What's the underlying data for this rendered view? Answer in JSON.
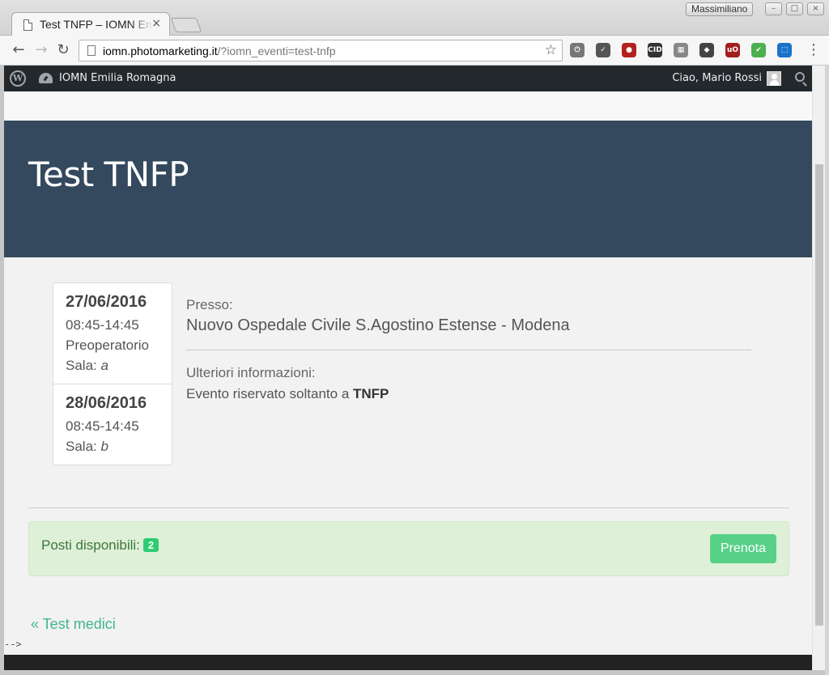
{
  "browser": {
    "tab_title": "Test TNFP – IOMN Emilia Romagna",
    "tab_close": "×",
    "profile_name": "Massimiliano",
    "window_buttons": [
      "–",
      "□",
      "×"
    ],
    "url_host": "iomn.photomarketing.it",
    "url_path": "/?iomn_eventi=test-tnfp",
    "back": "←",
    "forward": "→",
    "reload": "↻",
    "star": "☆",
    "menu": "⋮",
    "extensions": [
      {
        "name": "power-extension-icon",
        "label": "⏻",
        "color": "#777777"
      },
      {
        "name": "pocket-extension-icon",
        "label": "✓",
        "color": "#555555"
      },
      {
        "name": "map-pin-extension-icon",
        "label": "●",
        "color": "#b52020"
      },
      {
        "name": "cid-extension-icon",
        "label": "CID",
        "color": "#333333"
      },
      {
        "name": "bank-extension-icon",
        "label": "▦",
        "color": "#888888"
      },
      {
        "name": "bulb-extension-icon",
        "label": "◆",
        "color": "#444444"
      },
      {
        "name": "ublock-extension-icon",
        "label": "uO",
        "color": "#a31d1d"
      },
      {
        "name": "checkmark-extension-icon",
        "label": "✔",
        "color": "#4caf50"
      },
      {
        "name": "screenshot-extension-icon",
        "label": "⬚",
        "color": "#1a73c8"
      }
    ]
  },
  "adminbar": {
    "logo": "W",
    "site_name": "IOMN Emilia Romagna",
    "greeting": "Ciao, Mario Rossi"
  },
  "hero": {
    "title": "Test TNFP"
  },
  "dates": [
    {
      "date": "27/06/2016",
      "time": "08:45-14:45",
      "type": "Preoperatorio",
      "sala_label": "Sala:",
      "sala": "a"
    },
    {
      "date": "28/06/2016",
      "time": "08:45-14:45",
      "sala_label": "Sala:",
      "sala": "b"
    }
  ],
  "info": {
    "presso_label": "Presso:",
    "venue": "Nuovo Ospedale Civile S.Agostino Estense - Modena",
    "more_label": "Ulteriori informazioni:",
    "more_text": "Evento riservato soltanto a",
    "more_bold": "TNFP"
  },
  "booking": {
    "posti_label": "Posti disponibili:",
    "posti_count": "2",
    "button_label": "Prenota"
  },
  "back_link": "« Test medici",
  "stray_text": "-->",
  "colors": {
    "hero_bg": "#34495e",
    "accent_green": "#57d187",
    "badge_green": "#2ecc71",
    "link": "#3fb68b"
  }
}
